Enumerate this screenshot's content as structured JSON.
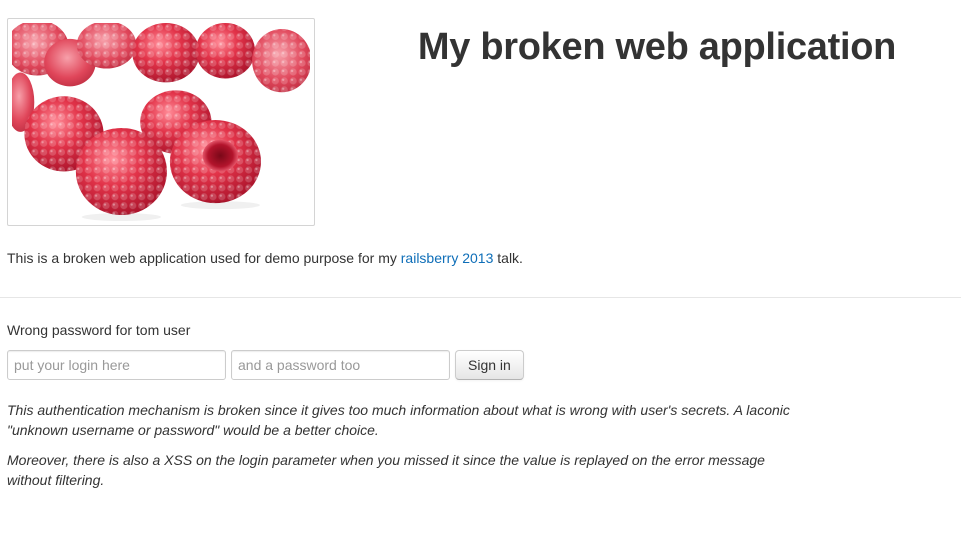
{
  "header": {
    "title": "My broken web application",
    "image_alt": "raspberries"
  },
  "intro": {
    "text_before": "This is a broken web application used for demo purpose for my ",
    "link_text": "railsberry 2013",
    "text_after": " talk."
  },
  "login": {
    "error_message": "Wrong password for tom user",
    "username_placeholder": "put your login here",
    "password_placeholder": "and a password too",
    "submit_label": "Sign in"
  },
  "notes": [
    "This authentication mechanism is broken since it gives too much information about what is wrong with user's secrets. A laconic \"unknown username or password\" would be a better choice.",
    "Moreover, there is also a XSS on the login parameter when you missed it since the value is replayed on the error message without filtering."
  ],
  "colors": {
    "link": "#0e6eb8",
    "text": "#333333",
    "raspberry": "#d8263f"
  }
}
